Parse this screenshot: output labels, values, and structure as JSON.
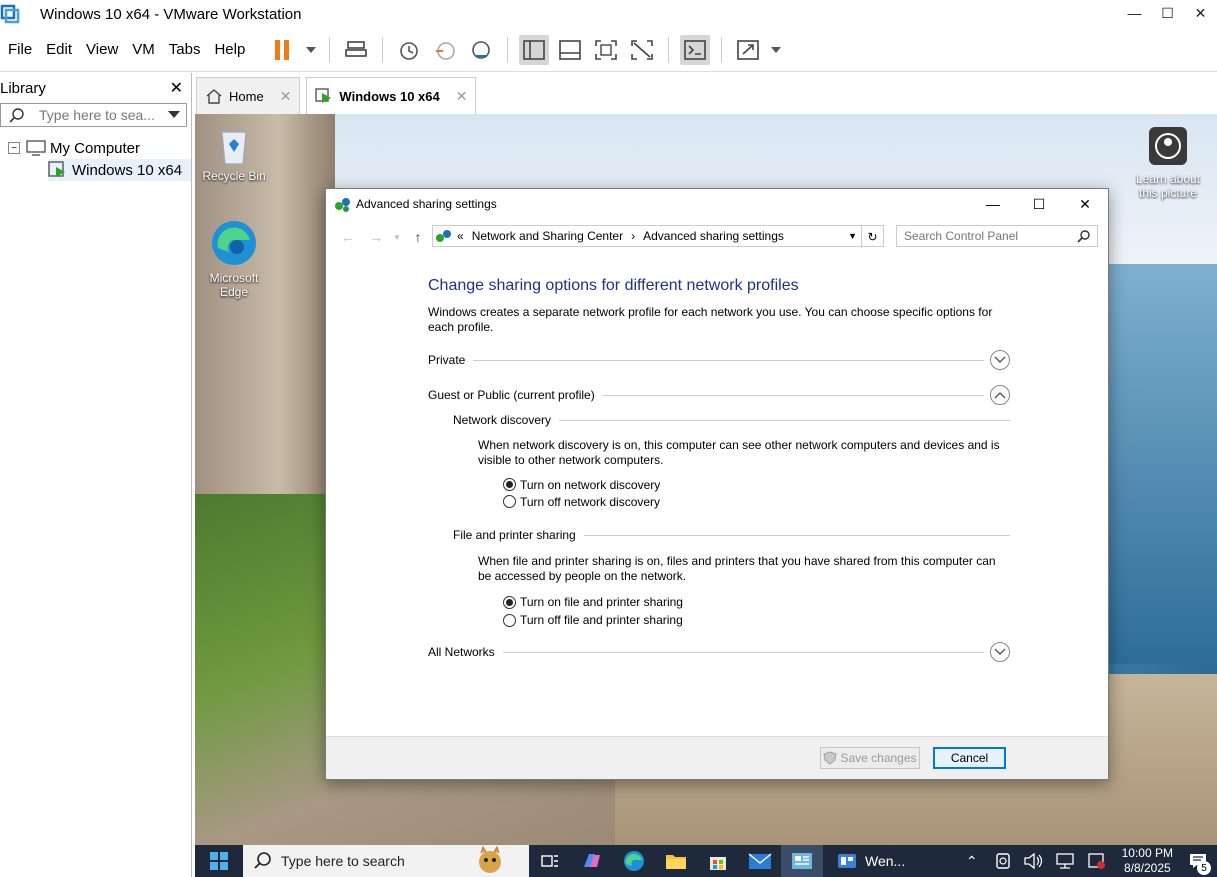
{
  "vm": {
    "title": "Windows 10 x64 - VMware Workstation",
    "menu": [
      "File",
      "Edit",
      "View",
      "VM",
      "Tabs",
      "Help"
    ]
  },
  "library": {
    "title": "Library",
    "search_placeholder": "Type here to sea...",
    "tree": [
      {
        "label": "My Computer"
      },
      {
        "label": "Windows 10 x64"
      }
    ]
  },
  "tabs": [
    {
      "label": "Home"
    },
    {
      "label": "Windows 10 x64"
    }
  ],
  "desktop": {
    "icons": [
      {
        "label": "Recycle Bin"
      },
      {
        "label": "Microsoft Edge"
      }
    ],
    "learn": "Learn about this picture"
  },
  "dialog": {
    "title": "Advanced sharing settings",
    "breadcrumb": [
      "Network and Sharing Center",
      "Advanced sharing settings"
    ],
    "search_placeholder": "Search Control Panel",
    "heading": "Change sharing options for different network profiles",
    "intro": "Windows creates a separate network profile for each network you use. You can choose specific options for each profile.",
    "profiles": {
      "private": "Private",
      "guest": "Guest or Public (current profile)",
      "all": "All Networks"
    },
    "discovery": {
      "title": "Network discovery",
      "desc": "When network discovery is on, this computer can see other network computers and devices and is visible to other network computers.",
      "on": "Turn on network discovery",
      "off": "Turn off network discovery",
      "selected": "on"
    },
    "sharing": {
      "title": "File and printer sharing",
      "desc": "When file and printer sharing is on, files and printers that you have shared from this computer can be accessed by people on the network.",
      "on": "Turn on file and printer sharing",
      "off": "Turn off file and printer sharing",
      "selected": "on"
    },
    "save": "Save changes",
    "cancel": "Cancel"
  },
  "taskbar": {
    "search_placeholder": "Type here to search",
    "app_label": "Wen...",
    "time": "10:00 PM",
    "date": "8/8/2025",
    "notif_count": "5"
  },
  "colors": {
    "accent": "#0078d7",
    "heading": "#1e3287",
    "taskbar": "#1e2a3c"
  }
}
